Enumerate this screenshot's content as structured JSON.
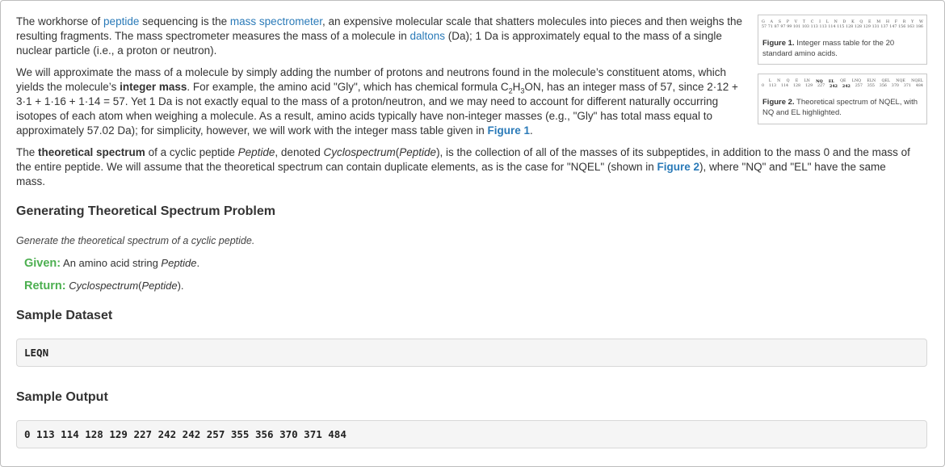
{
  "intro": {
    "p1_t1": "The workhorse of ",
    "link_peptide": "peptide",
    "p1_t2": " sequencing is the ",
    "link_mass_spec": "mass spectrometer",
    "p1_t3": ", an expensive molecular scale that shatters molecules into pieces and then weighs the resulting fragments. The mass spectrometer measures the mass of a molecule in ",
    "link_daltons": "daltons",
    "p1_t4": " (Da); 1 Da is approximately equal to the mass of a single nuclear particle (i.e., a proton or neutron).",
    "p2_t1": "We will approximate the mass of a molecule by simply adding the number of protons and neutrons found in the molecule’s constituent atoms, which yields the molecule’s ",
    "p2_bold": "integer mass",
    "p2_t2": ". For example, the amino acid \"Gly\", which has chemical formula C",
    "p2_sub1": "2",
    "p2_t3": "H",
    "p2_sub2": "3",
    "p2_t4": "ON, has an integer mass of 57, since 2·12 + 3·1 + 1·16 + 1·14 = 57. Yet 1 Da is not exactly equal to the mass of a proton/neutron, and we may need to account for different naturally occurring isotopes of each atom when weighing a molecule. As a result, amino acids typically have non-integer masses (e.g., \"Gly\" has total mass equal to approximately 57.02 Da); for simplicity, however, we will work with the integer mass table given in ",
    "p2_link": "Figure 1",
    "p2_t5": ".",
    "p3_t1": "The ",
    "p3_bold": "theoretical spectrum",
    "p3_t2": " of a cyclic peptide ",
    "p3_i1": "Peptide",
    "p3_t3": ", denoted ",
    "p3_i2": "Cyclospectrum",
    "p3_t4": "(",
    "p3_i3": "Peptide",
    "p3_t5": "), is the collection of all of the masses of its subpeptides, in addition to the mass 0 and the mass of the entire peptide. We will assume that the theoretical spectrum can contain duplicate elements, as is the case for \"NQEL\" (shown in ",
    "p3_link": "Figure 2",
    "p3_t6": "), where \"NQ\" and \"EL\" have the same mass."
  },
  "problem": {
    "title": "Generating Theoretical Spectrum Problem",
    "lead": "Generate the theoretical spectrum of a cyclic peptide.",
    "given_label": "Given:",
    "given_t1": " An amino acid string ",
    "given_i": "Peptide",
    "given_t2": ".",
    "return_label": "Return:",
    "return_i1": "Cyclospectrum",
    "return_t1": "(",
    "return_i2": "Peptide",
    "return_t2": ")."
  },
  "sample_dataset": {
    "title": "Sample Dataset",
    "value": "LEQN"
  },
  "sample_output": {
    "title": "Sample Output",
    "value": "0 113 114 128 129 227 242 242 257 355 356 370 371 484"
  },
  "figure1": {
    "letters": [
      "G",
      "A",
      "S",
      "P",
      "V",
      "T",
      "C",
      "I",
      "L",
      "N",
      "D",
      "K",
      "Q",
      "E",
      "M",
      "H",
      "F",
      "R",
      "Y",
      "W"
    ],
    "masses": [
      "57",
      "71",
      "87",
      "97",
      "99",
      "101",
      "103",
      "113",
      "113",
      "114",
      "115",
      "128",
      "128",
      "129",
      "131",
      "137",
      "147",
      "156",
      "163",
      "186"
    ],
    "caption_label": "Figure 1.",
    "caption_text": " Integer mass table for the 20 standard amino acids."
  },
  "figure2": {
    "labels": [
      "",
      "L",
      "N",
      "Q",
      "E",
      "LN",
      "NQ",
      "EL",
      "QE",
      "LNQ",
      "ELN",
      "QEL",
      "NQE",
      "NQEL"
    ],
    "masses": [
      "0",
      "113",
      "114",
      "128",
      "129",
      "227",
      "242",
      "242",
      "257",
      "355",
      "356",
      "370",
      "371",
      "484"
    ],
    "caption_label": "Figure 2.",
    "caption_text": " Theoretical spectrum of NQEL, with NQ and EL highlighted."
  }
}
